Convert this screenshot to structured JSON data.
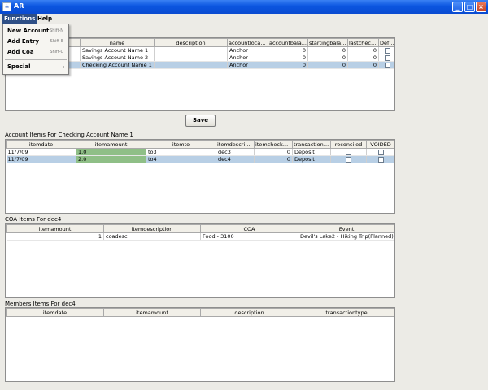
{
  "window": {
    "title": "AR",
    "icon_label": "☕",
    "minimize_glyph": "_",
    "maximize_glyph": "□",
    "close_glyph": "×"
  },
  "menubar": {
    "functions_label": "Functions",
    "help_label": "Help"
  },
  "functions_menu": {
    "items": [
      {
        "label": "New Account",
        "shortcut": "Shift-N"
      },
      {
        "label": "Add Entry",
        "shortcut": "Shift-E"
      },
      {
        "label": "Add Coa",
        "shortcut": "Shift-C"
      },
      {
        "label": "Special",
        "submenu_arrow": "▸"
      }
    ]
  },
  "accounts_table": {
    "columns": [
      "",
      "name",
      "description",
      "accountlocati...",
      "accountbala...",
      "startingbalan...",
      "lastcheck...",
      "Defa..."
    ],
    "rows": [
      {
        "id": "",
        "name": "Savings Account Name 1",
        "description": "",
        "location": "Anchor",
        "balance": "0",
        "starting": "0",
        "lastcheck": "0"
      },
      {
        "id": "",
        "name": "Savings Account Name 2",
        "description": "",
        "location": "Anchor",
        "balance": "0",
        "starting": "0",
        "lastcheck": "0"
      },
      {
        "id": "",
        "name": "Checking Account Name 1",
        "description": "",
        "location": "Anchor",
        "balance": "0",
        "starting": "0",
        "lastcheck": "0"
      }
    ]
  },
  "save_button": {
    "label": "Save"
  },
  "account_items": {
    "section_label": "Account Items For Checking Account Name 1",
    "columns": [
      "itemdate",
      "itemamount",
      "itemto",
      "itemdescripti...",
      "itemcheckn...",
      "transactiont...",
      "reconciled",
      "VOIDED"
    ],
    "rows": [
      {
        "date": "11/7/09",
        "amount": "1.0",
        "to": "to3",
        "desc": "dec3",
        "check": "0",
        "type": "Deposit"
      },
      {
        "date": "11/7/09",
        "amount": "2.0",
        "to": "to4",
        "desc": "dec4",
        "check": "0",
        "type": "Deposit"
      }
    ]
  },
  "coa_items": {
    "section_label": "COA Items For dec4",
    "columns": [
      "itemamount",
      "itemdescription",
      "COA",
      "Event"
    ],
    "rows": [
      {
        "amount": "1",
        "description": "coadesc",
        "coa": "Food - 3100",
        "event": "Devil's Lake2 - Hiking Trip(Planned)"
      }
    ]
  },
  "members_items": {
    "section_label": "Members Items For dec4",
    "columns": [
      "itemdate",
      "itemamount",
      "description",
      "transactiontype"
    ]
  }
}
